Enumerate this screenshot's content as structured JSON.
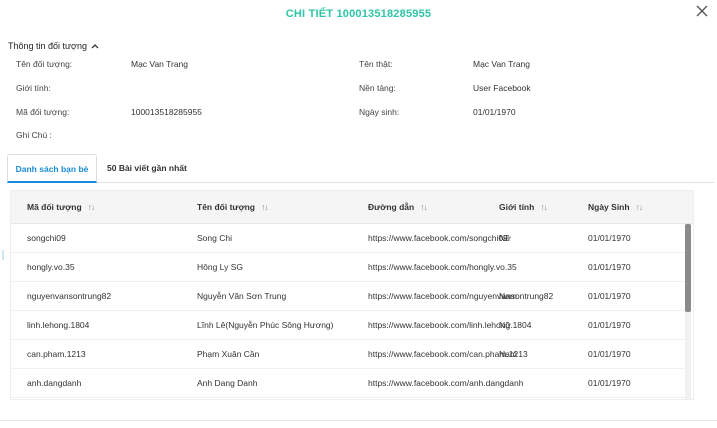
{
  "dialog": {
    "title": "CHI TIẾT 100013518285955",
    "close_label": "×"
  },
  "section": {
    "heading": "Thông tin đối tượng"
  },
  "info": {
    "ten_doi_tuong_label": "Tên đối tượng:",
    "ten_doi_tuong_value": "Mạc Van Trang",
    "ten_that_label": "Tên thật:",
    "ten_that_value": "Mạc Van Trang",
    "gioi_tinh_label": "Giới tính:",
    "gioi_tinh_value": "",
    "nen_tang_label": "Nền tảng:",
    "nen_tang_value": "User Facebook",
    "ma_doi_tuong_label": "Mã đối tượng:",
    "ma_doi_tuong_value": "100013518285955",
    "ngay_sinh_label": "Ngày sinh:",
    "ngay_sinh_value": "01/01/1970",
    "ghi_chu_label": "Ghi Chú :"
  },
  "tabs": [
    {
      "label": "Danh sách bạn bè",
      "active": true
    },
    {
      "label": "50 Bài viết gần nhất",
      "active": false
    }
  ],
  "table": {
    "headers": [
      "Mã đối tượng",
      "Tên đối tượng",
      "Đường dẫn",
      "Giới tính",
      "Ngày Sinh"
    ],
    "sort_glyph": "↑↓",
    "rows": [
      {
        "ma": "songchi09",
        "ten": "Song Chi",
        "link": "https://www.facebook.com/songchi09",
        "gioi": "Nữ",
        "ngay": "01/01/1970"
      },
      {
        "ma": "hongly.vo.35",
        "ten": "Hông Ly SG",
        "link": "https://www.facebook.com/hongly.vo.35",
        "gioi": "",
        "ngay": "01/01/1970"
      },
      {
        "ma": "nguyenvansontrung82",
        "ten": "Nguyễn Văn Sơn Trung",
        "link": "https://www.facebook.com/nguyenvansontrung82",
        "gioi": "Nam",
        "ngay": "01/01/1970"
      },
      {
        "ma": "linh.lehong.1804",
        "ten": "Lĩnh Lê(Nguyễn Phúc Sông Hương)",
        "link": "https://www.facebook.com/linh.lehong.1804",
        "gioi": "Nữ",
        "ngay": "01/01/1970"
      },
      {
        "ma": "can.pham.1213",
        "ten": "Phạm Xuân Cần",
        "link": "https://www.facebook.com/can.pham.1213",
        "gioi": "Nam",
        "ngay": "01/01/1970"
      },
      {
        "ma": "anh.dangdanh",
        "ten": "Anh Dang Danh",
        "link": "https://www.facebook.com/anh.dangdanh",
        "gioi": "",
        "ngay": "01/01/1970"
      }
    ]
  },
  "colors": {
    "title": "#2ec4a6",
    "active_tab": "#1a8cd8",
    "scroll_thumb": "#8a8a8a"
  }
}
